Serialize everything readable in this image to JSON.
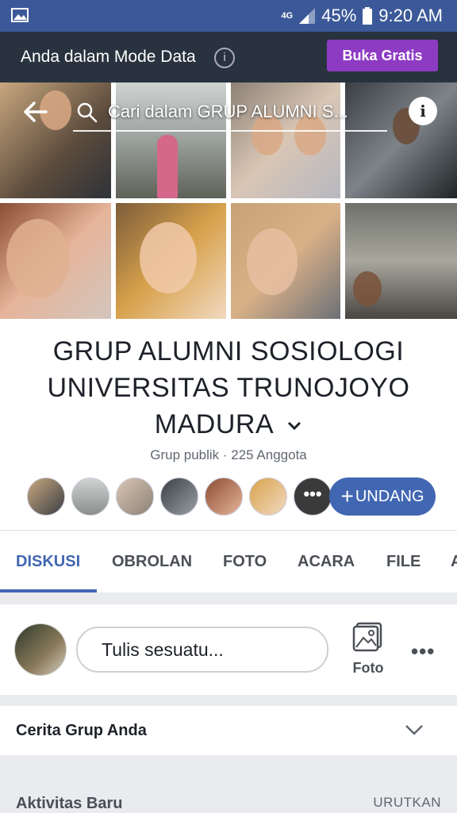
{
  "status_bar": {
    "network": "4G",
    "battery": "45%",
    "time": "9:20 AM"
  },
  "data_mode_banner": {
    "message": "Anda dalam Mode Data",
    "button_label": "Buka Gratis",
    "button_color": "#8e3bc4"
  },
  "cover": {
    "search_placeholder": "Cari dalam GRUP ALUMNI S..."
  },
  "group": {
    "title_line1": "GRUP ALUMNI SOSIOLOGI",
    "title_line2": "UNIVERSITAS TRUNOJOYO",
    "title_line3": "MADURA",
    "meta": "Grup publik · 225 Anggota",
    "more_members": "•••",
    "invite_plus": "+",
    "invite_label": "UNDANG"
  },
  "tabs": [
    {
      "label": "DISKUSI",
      "active": true
    },
    {
      "label": "OBROLAN"
    },
    {
      "label": "FOTO"
    },
    {
      "label": "ACARA"
    },
    {
      "label": "FILE"
    },
    {
      "label": "A"
    }
  ],
  "composer": {
    "placeholder": "Tulis sesuatu...",
    "photo_label": "Foto",
    "more": "•••"
  },
  "story": {
    "label": "Cerita Grup Anda"
  },
  "activity": {
    "label": "Aktivitas Baru",
    "sort_label": "URUTKAN"
  },
  "colors": {
    "facebook_blue": "#3b5998",
    "accent_blue": "#4267b2",
    "dark_bar": "#29333f"
  }
}
